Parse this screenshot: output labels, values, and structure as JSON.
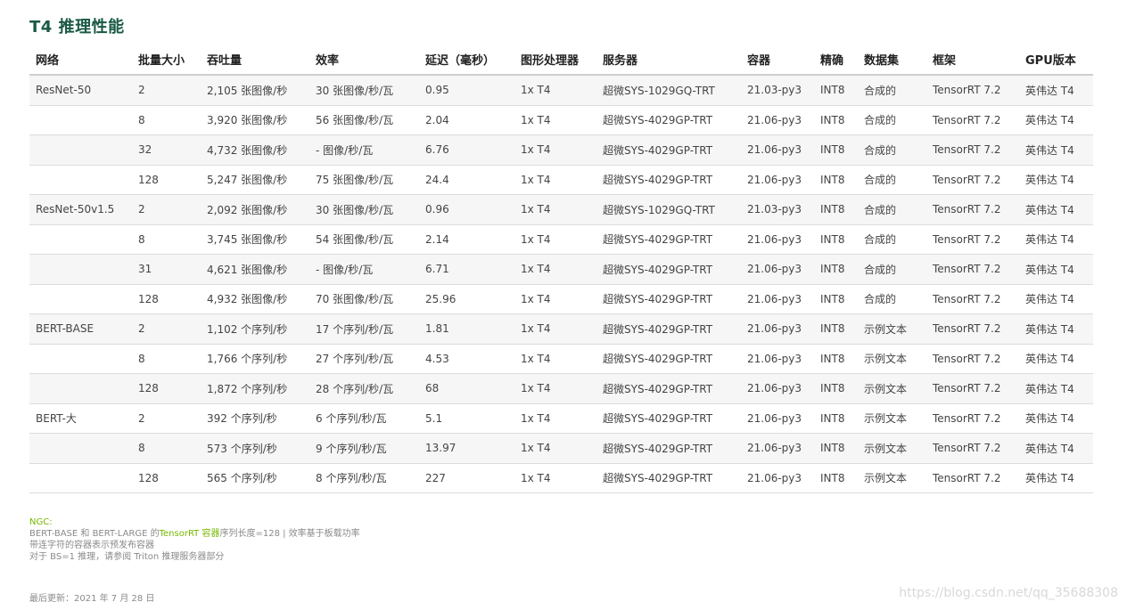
{
  "title": "T4 推理性能",
  "table": {
    "headers": [
      "网络",
      "批量大小",
      "吞吐量",
      "效率",
      "延迟（毫秒）",
      "图形处理器",
      "服务器",
      "容器",
      "精确",
      "数据集",
      "框架",
      "GPU版本"
    ],
    "rows": [
      [
        "ResNet-50",
        "2",
        "2,105 张图像/秒",
        "30 张图像/秒/瓦",
        "0.95",
        "1x T4",
        "超微SYS-1029GQ-TRT",
        "21.03-py3",
        "INT8",
        "合成的",
        "TensorRT 7.2",
        "英伟达 T4"
      ],
      [
        "",
        "8",
        "3,920 张图像/秒",
        "56 张图像/秒/瓦",
        "2.04",
        "1x T4",
        "超微SYS-4029GP-TRT",
        "21.06-py3",
        "INT8",
        "合成的",
        "TensorRT 7.2",
        "英伟达 T4"
      ],
      [
        "",
        "32",
        "4,732 张图像/秒",
        "- 图像/秒/瓦",
        "6.76",
        "1x T4",
        "超微SYS-4029GP-TRT",
        "21.06-py3",
        "INT8",
        "合成的",
        "TensorRT 7.2",
        "英伟达 T4"
      ],
      [
        "",
        "128",
        "5,247 张图像/秒",
        "75 张图像/秒/瓦",
        "24.4",
        "1x T4",
        "超微SYS-4029GP-TRT",
        "21.06-py3",
        "INT8",
        "合成的",
        "TensorRT 7.2",
        "英伟达 T4"
      ],
      [
        "ResNet-50v1.5",
        "2",
        "2,092 张图像/秒",
        "30 张图像/秒/瓦",
        "0.96",
        "1x T4",
        "超微SYS-1029GQ-TRT",
        "21.03-py3",
        "INT8",
        "合成的",
        "TensorRT 7.2",
        "英伟达 T4"
      ],
      [
        "",
        "8",
        "3,745 张图像/秒",
        "54 张图像/秒/瓦",
        "2.14",
        "1x T4",
        "超微SYS-4029GP-TRT",
        "21.06-py3",
        "INT8",
        "合成的",
        "TensorRT 7.2",
        "英伟达 T4"
      ],
      [
        "",
        "31",
        "4,621 张图像/秒",
        "- 图像/秒/瓦",
        "6.71",
        "1x T4",
        "超微SYS-4029GP-TRT",
        "21.06-py3",
        "INT8",
        "合成的",
        "TensorRT 7.2",
        "英伟达 T4"
      ],
      [
        "",
        "128",
        "4,932 张图像/秒",
        "70 张图像/秒/瓦",
        "25.96",
        "1x T4",
        "超微SYS-4029GP-TRT",
        "21.06-py3",
        "INT8",
        "合成的",
        "TensorRT 7.2",
        "英伟达 T4"
      ],
      [
        "BERT-BASE",
        "2",
        "1,102 个序列/秒",
        "17 个序列/秒/瓦",
        "1.81",
        "1x T4",
        "超微SYS-4029GP-TRT",
        "21.06-py3",
        "INT8",
        "示例文本",
        "TensorRT 7.2",
        "英伟达 T4"
      ],
      [
        "",
        "8",
        "1,766 个序列/秒",
        "27 个序列/秒/瓦",
        "4.53",
        "1x T4",
        "超微SYS-4029GP-TRT",
        "21.06-py3",
        "INT8",
        "示例文本",
        "TensorRT 7.2",
        "英伟达 T4"
      ],
      [
        "",
        "128",
        "1,872 个序列/秒",
        "28 个序列/秒/瓦",
        "68",
        "1x T4",
        "超微SYS-4029GP-TRT",
        "21.06-py3",
        "INT8",
        "示例文本",
        "TensorRT 7.2",
        "英伟达 T4"
      ],
      [
        "BERT-大",
        "2",
        "392 个序列/秒",
        "6 个序列/秒/瓦",
        "5.1",
        "1x T4",
        "超微SYS-4029GP-TRT",
        "21.06-py3",
        "INT8",
        "示例文本",
        "TensorRT 7.2",
        "英伟达 T4"
      ],
      [
        "",
        "8",
        "573 个序列/秒",
        "9 个序列/秒/瓦",
        "13.97",
        "1x T4",
        "超微SYS-4029GP-TRT",
        "21.06-py3",
        "INT8",
        "示例文本",
        "TensorRT 7.2",
        "英伟达 T4"
      ],
      [
        "",
        "128",
        "565 个序列/秒",
        "8 个序列/秒/瓦",
        "227",
        "1x T4",
        "超微SYS-4029GP-TRT",
        "21.06-py3",
        "INT8",
        "示例文本",
        "TensorRT 7.2",
        "英伟达 T4"
      ]
    ]
  },
  "notes": {
    "ngc": "NGC:",
    "line1_pre": "BERT-BASE 和 BERT-LARGE 的",
    "line1_link": "TensorRT 容器",
    "line1_post": "序列长度=128 | 效率基于板载功率",
    "line2": "带连字符的容器表示预发布容器",
    "line3": "对于 BS=1 推理，请参阅 Triton 推理服务器部分"
  },
  "updated": "最后更新：2021 年 7 月 28 日",
  "watermark": "https://blog.csdn.net/qq_35688308",
  "colors": {
    "accent": "#76b900",
    "title": "#1a5a45",
    "text": "#444444"
  }
}
